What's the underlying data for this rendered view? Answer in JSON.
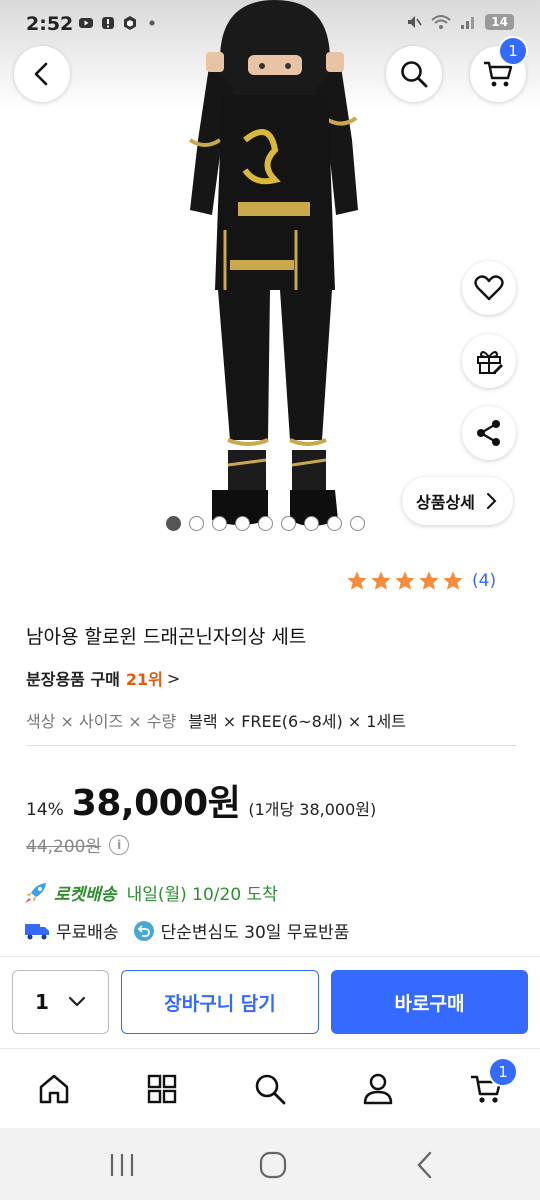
{
  "status_bar": {
    "time": "2:52",
    "battery": "14"
  },
  "top_bar": {
    "cart_badge": "1"
  },
  "detail_button": {
    "label": "상품상세"
  },
  "carousel": {
    "count": 9,
    "active_index": 0
  },
  "rating": {
    "stars": 5,
    "count_label": "(4)"
  },
  "product": {
    "title": "남아용 할로윈 드래곤닌자의상 세트",
    "rank_category": "분장용품 구매",
    "rank": "21위",
    "rank_chevron": ">",
    "option_label": "색상 × 사이즈 × 수량",
    "option_value": "블랙 × FREE(6~8세) × 1세트",
    "discount": "14%",
    "price": "38,000원",
    "unit_price": "(1개당 38,000원)",
    "original_price": "44,200원",
    "info_icon": "i"
  },
  "delivery": {
    "rocket_label": "로켓배송",
    "arrival": "내일(월) 10/20 도착",
    "free_shipping": "무료배송",
    "free_return": "단순변심도 30일 무료반품"
  },
  "purchase_bar": {
    "quantity": "1",
    "add_to_cart": "장바구니 담기",
    "buy_now": "바로구매"
  },
  "bottom_nav": {
    "cart_badge": "1"
  },
  "colors": {
    "accent": "#346aff",
    "rocket_green": "#2d8f2d",
    "rank_orange": "#e8590c",
    "star": "#f68b3a"
  },
  "icons": [
    "back-icon",
    "search-icon",
    "cart-icon",
    "heart-icon",
    "gift-icon",
    "share-icon",
    "chevron-right-icon",
    "star-icon",
    "info-icon",
    "rocket-icon",
    "truck-icon",
    "return-icon",
    "chevron-down-icon",
    "home-icon",
    "category-icon",
    "person-icon",
    "recent-apps-icon",
    "home-circle-icon",
    "back-nav-icon"
  ]
}
